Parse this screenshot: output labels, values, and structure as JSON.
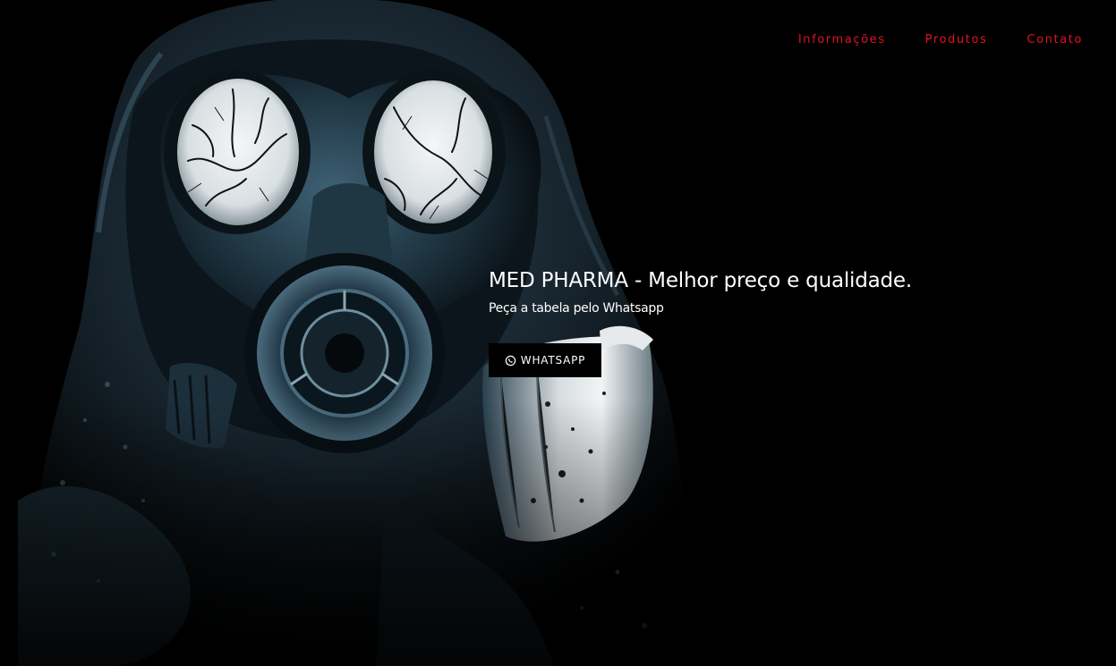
{
  "nav": {
    "items": [
      {
        "label": "Informações"
      },
      {
        "label": "Produtos"
      },
      {
        "label": "Contato"
      }
    ]
  },
  "hero": {
    "title": "MED PHARMA - Melhor preço e qualidade.",
    "subtitle": "Peça a tabela pelo Whatsapp",
    "cta_label": "WHATSAPP",
    "cta_icon": "whatsapp-icon",
    "image_subject": "gas-mask-figure"
  },
  "colors": {
    "background": "#000000",
    "nav_text": "#e0141e",
    "hero_text": "#ffffff",
    "button_bg": "#000000",
    "button_text": "#ffffff"
  }
}
